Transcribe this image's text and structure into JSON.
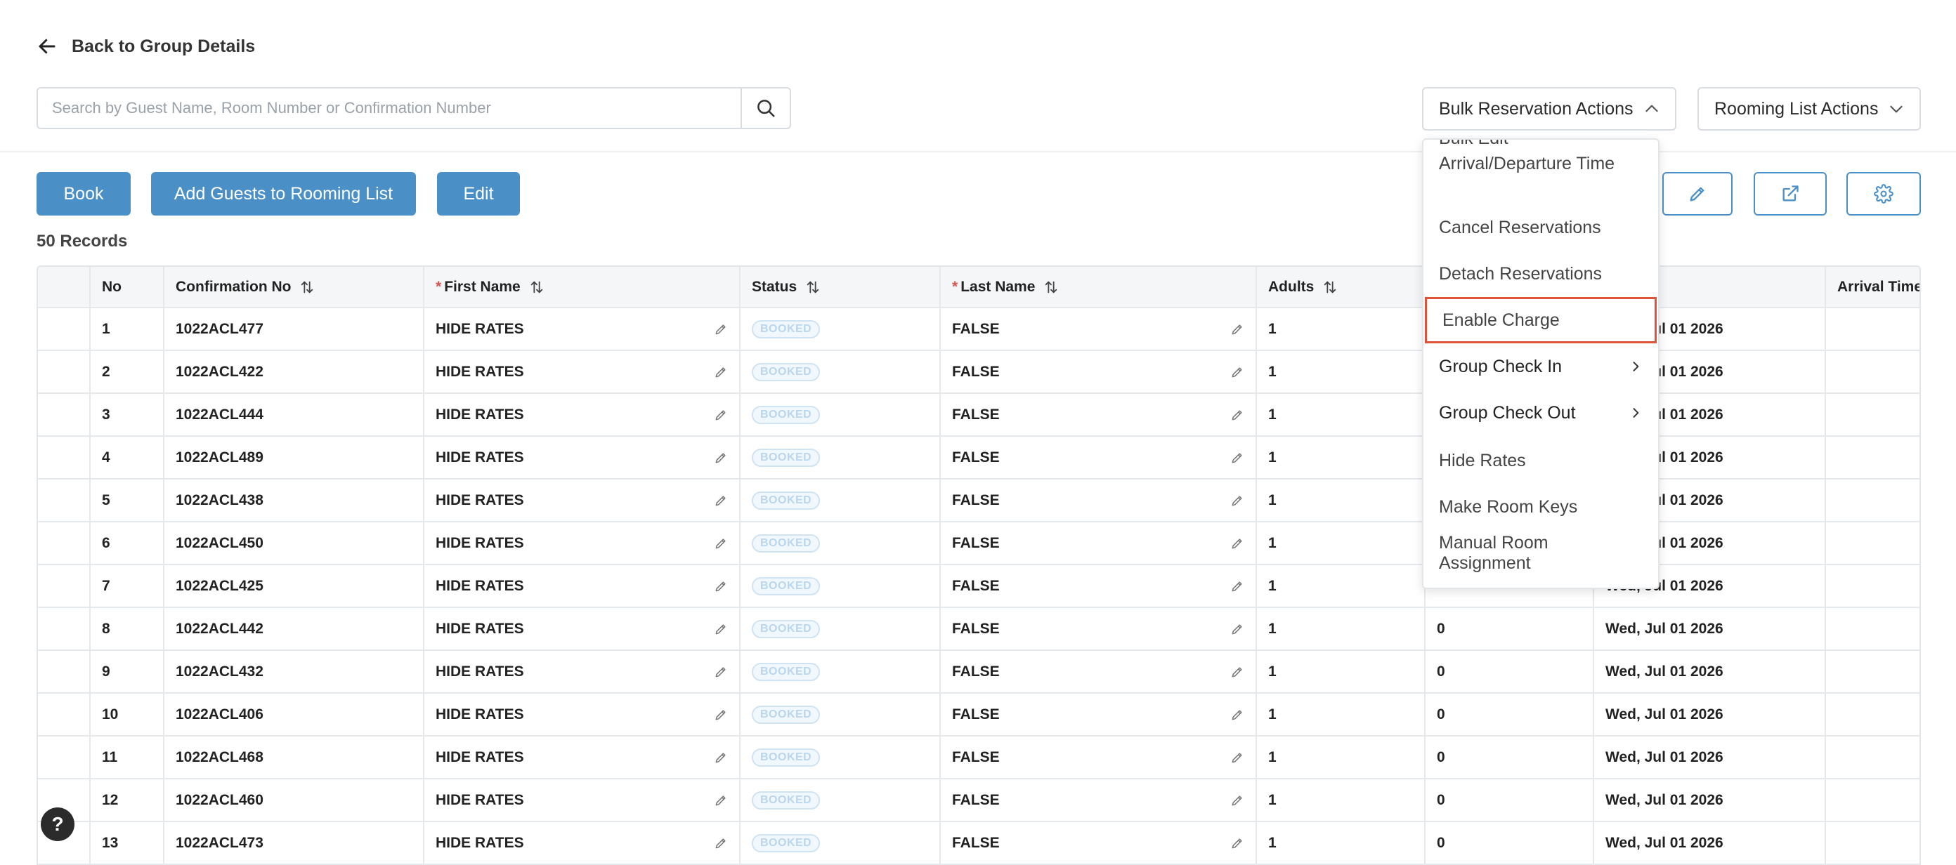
{
  "header": {
    "back_label": "Back to Group Details"
  },
  "search": {
    "placeholder": "Search by Guest Name, Room Number or Confirmation Number",
    "value": ""
  },
  "bulk_actions": {
    "label": "Bulk Reservation Actions",
    "menu": [
      {
        "label": "Bulk Edit Arrival/Departure Time",
        "submenu": false
      },
      {
        "label": "Cancel Reservations",
        "submenu": false
      },
      {
        "label": "Detach Reservations",
        "submenu": false
      },
      {
        "label": "Enable Charge",
        "submenu": false,
        "selected": true
      },
      {
        "label": "Group Check In",
        "submenu": true
      },
      {
        "label": "Group Check Out",
        "submenu": true
      },
      {
        "label": "Hide Rates",
        "submenu": false
      },
      {
        "label": "Make Room Keys",
        "submenu": false
      },
      {
        "label": "Manual Room Assignment",
        "submenu": false
      }
    ]
  },
  "rooming_actions": {
    "label": "Rooming List Actions"
  },
  "toolbar": {
    "book_label": "Book",
    "add_guests_label": "Add Guests to Rooming List",
    "edit_label": "Edit",
    "icon_buttons": [
      "pencil-icon",
      "external-link-icon",
      "gear-icon"
    ]
  },
  "records_label": "50 Records",
  "table": {
    "columns": [
      {
        "label": "",
        "required": false,
        "sortable": false
      },
      {
        "label": "No",
        "required": false,
        "sortable": false
      },
      {
        "label": "Confirmation No",
        "required": false,
        "sortable": true
      },
      {
        "label": "First Name",
        "required": true,
        "sortable": true
      },
      {
        "label": "Status",
        "required": false,
        "sortable": true
      },
      {
        "label": "Last Name",
        "required": true,
        "sortable": true
      },
      {
        "label": "Adults",
        "required": false,
        "sortable": true
      },
      {
        "label": "",
        "required": false,
        "sortable": false
      },
      {
        "label": "",
        "required": false,
        "sortable": true
      },
      {
        "label": "Arrival Time",
        "required": false,
        "sortable": false
      }
    ],
    "rows": [
      {
        "no": "1",
        "conf": "1022ACL477",
        "first": "HIDE RATES",
        "status": "BOOKED",
        "last": "FALSE",
        "adults": "1",
        "children": "",
        "arrival": "Wed, Jul 01 2026"
      },
      {
        "no": "2",
        "conf": "1022ACL422",
        "first": "HIDE RATES",
        "status": "BOOKED",
        "last": "FALSE",
        "adults": "1",
        "children": "",
        "arrival": "Wed, Jul 01 2026"
      },
      {
        "no": "3",
        "conf": "1022ACL444",
        "first": "HIDE RATES",
        "status": "BOOKED",
        "last": "FALSE",
        "adults": "1",
        "children": "",
        "arrival": "Wed, Jul 01 2026"
      },
      {
        "no": "4",
        "conf": "1022ACL489",
        "first": "HIDE RATES",
        "status": "BOOKED",
        "last": "FALSE",
        "adults": "1",
        "children": "",
        "arrival": "Wed, Jul 01 2026"
      },
      {
        "no": "5",
        "conf": "1022ACL438",
        "first": "HIDE RATES",
        "status": "BOOKED",
        "last": "FALSE",
        "adults": "1",
        "children": "",
        "arrival": "Wed, Jul 01 2026"
      },
      {
        "no": "6",
        "conf": "1022ACL450",
        "first": "HIDE RATES",
        "status": "BOOKED",
        "last": "FALSE",
        "adults": "1",
        "children": "",
        "arrival": "Wed, Jul 01 2026"
      },
      {
        "no": "7",
        "conf": "1022ACL425",
        "first": "HIDE RATES",
        "status": "BOOKED",
        "last": "FALSE",
        "adults": "1",
        "children": "",
        "arrival": "Wed, Jul 01 2026"
      },
      {
        "no": "8",
        "conf": "1022ACL442",
        "first": "HIDE RATES",
        "status": "BOOKED",
        "last": "FALSE",
        "adults": "1",
        "children": "0",
        "arrival": "Wed, Jul 01 2026"
      },
      {
        "no": "9",
        "conf": "1022ACL432",
        "first": "HIDE RATES",
        "status": "BOOKED",
        "last": "FALSE",
        "adults": "1",
        "children": "0",
        "arrival": "Wed, Jul 01 2026"
      },
      {
        "no": "10",
        "conf": "1022ACL406",
        "first": "HIDE RATES",
        "status": "BOOKED",
        "last": "FALSE",
        "adults": "1",
        "children": "0",
        "arrival": "Wed, Jul 01 2026"
      },
      {
        "no": "11",
        "conf": "1022ACL468",
        "first": "HIDE RATES",
        "status": "BOOKED",
        "last": "FALSE",
        "adults": "1",
        "children": "0",
        "arrival": "Wed, Jul 01 2026"
      },
      {
        "no": "12",
        "conf": "1022ACL460",
        "first": "HIDE RATES",
        "status": "BOOKED",
        "last": "FALSE",
        "adults": "1",
        "children": "0",
        "arrival": "Wed, Jul 01 2026"
      },
      {
        "no": "13",
        "conf": "1022ACL473",
        "first": "HIDE RATES",
        "status": "BOOKED",
        "last": "FALSE",
        "adults": "1",
        "children": "0",
        "arrival": "Wed, Jul 01 2026"
      }
    ]
  },
  "help": {
    "label": "?"
  }
}
